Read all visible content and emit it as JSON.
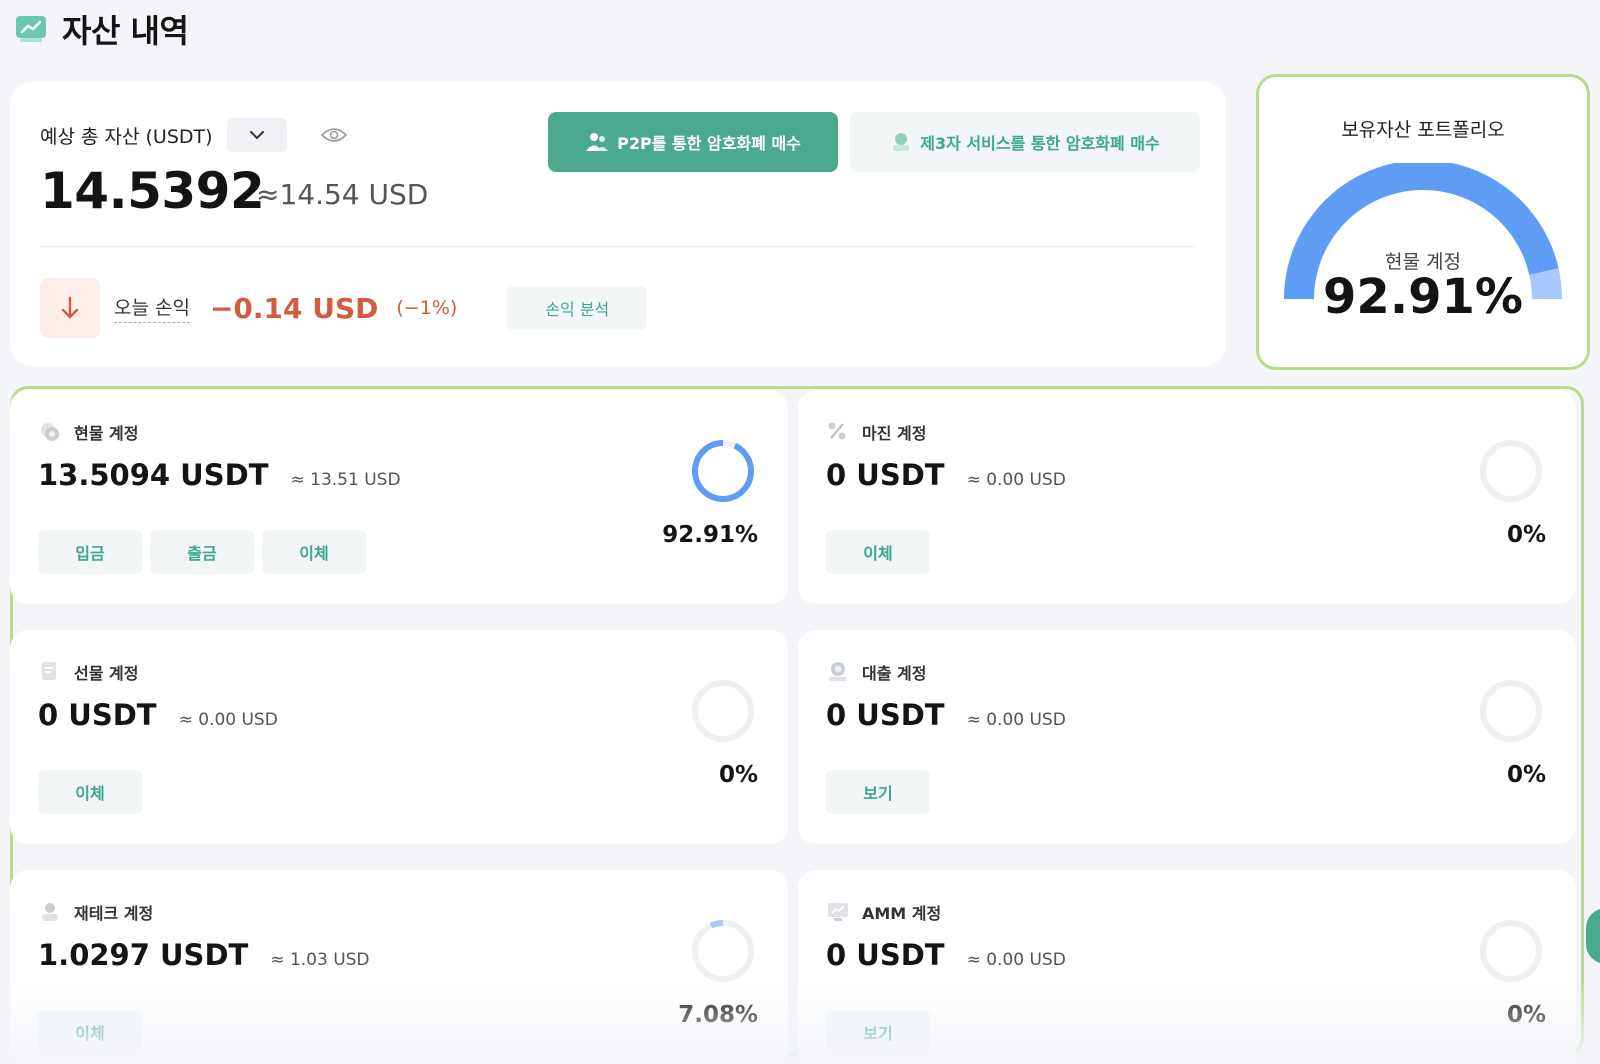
{
  "header": {
    "title": "자산 내역",
    "icon": "chart-trend-icon"
  },
  "summary": {
    "total_label": "예상 총 자산 (USDT)",
    "total_value": "14.5392",
    "total_usd": "≈14.54 USD",
    "pnl_label": "오늘 손익",
    "pnl_value": "−0.14 USD",
    "pnl_pct": "(−1%)",
    "analysis_btn": "손익 분석",
    "p2p_btn": "P2P를 통한 암호화폐 매수",
    "third_party_btn": "제3자 서비스를 통한 암호화폐 매수"
  },
  "portfolio": {
    "title": "보유자산 포트폴리오",
    "main_label": "현물 계정",
    "main_value": "92.91%",
    "main_fraction": 0.9291,
    "colors": {
      "primary": "#5e9cf5",
      "secondary": "#a7c8fa"
    }
  },
  "accounts": [
    {
      "name": "현물 계정",
      "icon": "coins-icon",
      "amount": "13.5094 USDT",
      "usd": "≈ 13.51 USD",
      "pct": "92.91%",
      "fraction": 0.9291,
      "buttons": [
        "입금",
        "출금",
        "이체"
      ]
    },
    {
      "name": "마진 계정",
      "icon": "percent-icon",
      "amount": "0 USDT",
      "usd": "≈ 0.00 USD",
      "pct": "0%",
      "fraction": 0,
      "buttons": [
        "이체"
      ]
    },
    {
      "name": "선물 계정",
      "icon": "document-icon",
      "amount": "0 USDT",
      "usd": "≈ 0.00 USD",
      "pct": "0%",
      "fraction": 0,
      "buttons": [
        "이체"
      ]
    },
    {
      "name": "대출 계정",
      "icon": "loan-icon",
      "amount": "0 USDT",
      "usd": "≈ 0.00 USD",
      "pct": "0%",
      "fraction": 0,
      "buttons": [
        "보기"
      ]
    },
    {
      "name": "재테크 계정",
      "icon": "user-savings-icon",
      "amount": "1.0297 USDT",
      "usd": "≈ 1.03 USD",
      "pct": "7.08%",
      "fraction": 0.0708,
      "buttons": [
        "이체"
      ]
    },
    {
      "name": "AMM 계정",
      "icon": "monitor-icon",
      "amount": "0 USDT",
      "usd": "≈ 0.00 USD",
      "pct": "0%",
      "fraction": 0,
      "buttons": [
        "보기"
      ]
    }
  ],
  "colors": {
    "accent": "#4baa8d",
    "loss": "#d35b3f",
    "ring_active": "#5e9cf5",
    "ring_secondary": "#a7c8fa",
    "ring_track": "#eef0f3"
  }
}
